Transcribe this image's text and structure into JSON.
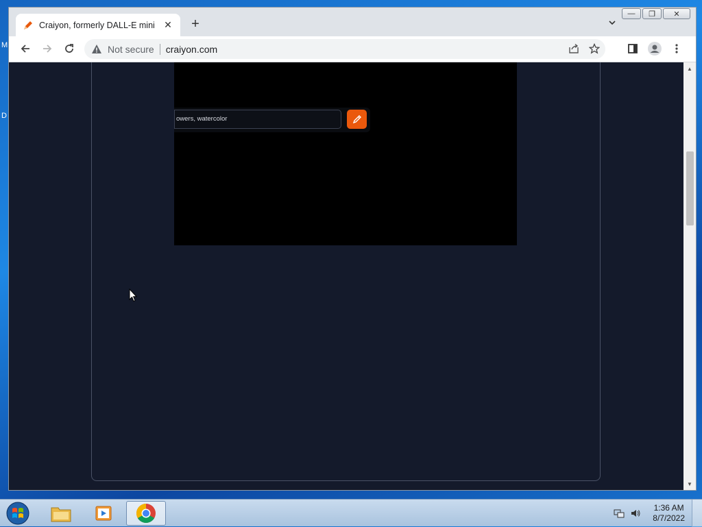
{
  "desktop": {
    "labels": [
      "M",
      "D"
    ]
  },
  "browser": {
    "tab": {
      "title": "Craiyon, formerly DALL-E mini"
    },
    "address": {
      "security_label": "Not secure",
      "url": "craiyon.com"
    }
  },
  "page": {
    "video": {
      "prompt_text": "owers, watercolor",
      "accent_color": "#ea580c"
    },
    "scroll_fraction": 0.28
  },
  "taskbar": {
    "clock": {
      "time": "1:36 AM",
      "date": "8/7/2022"
    },
    "items": [
      "file-explorer",
      "media-player",
      "chrome"
    ]
  }
}
